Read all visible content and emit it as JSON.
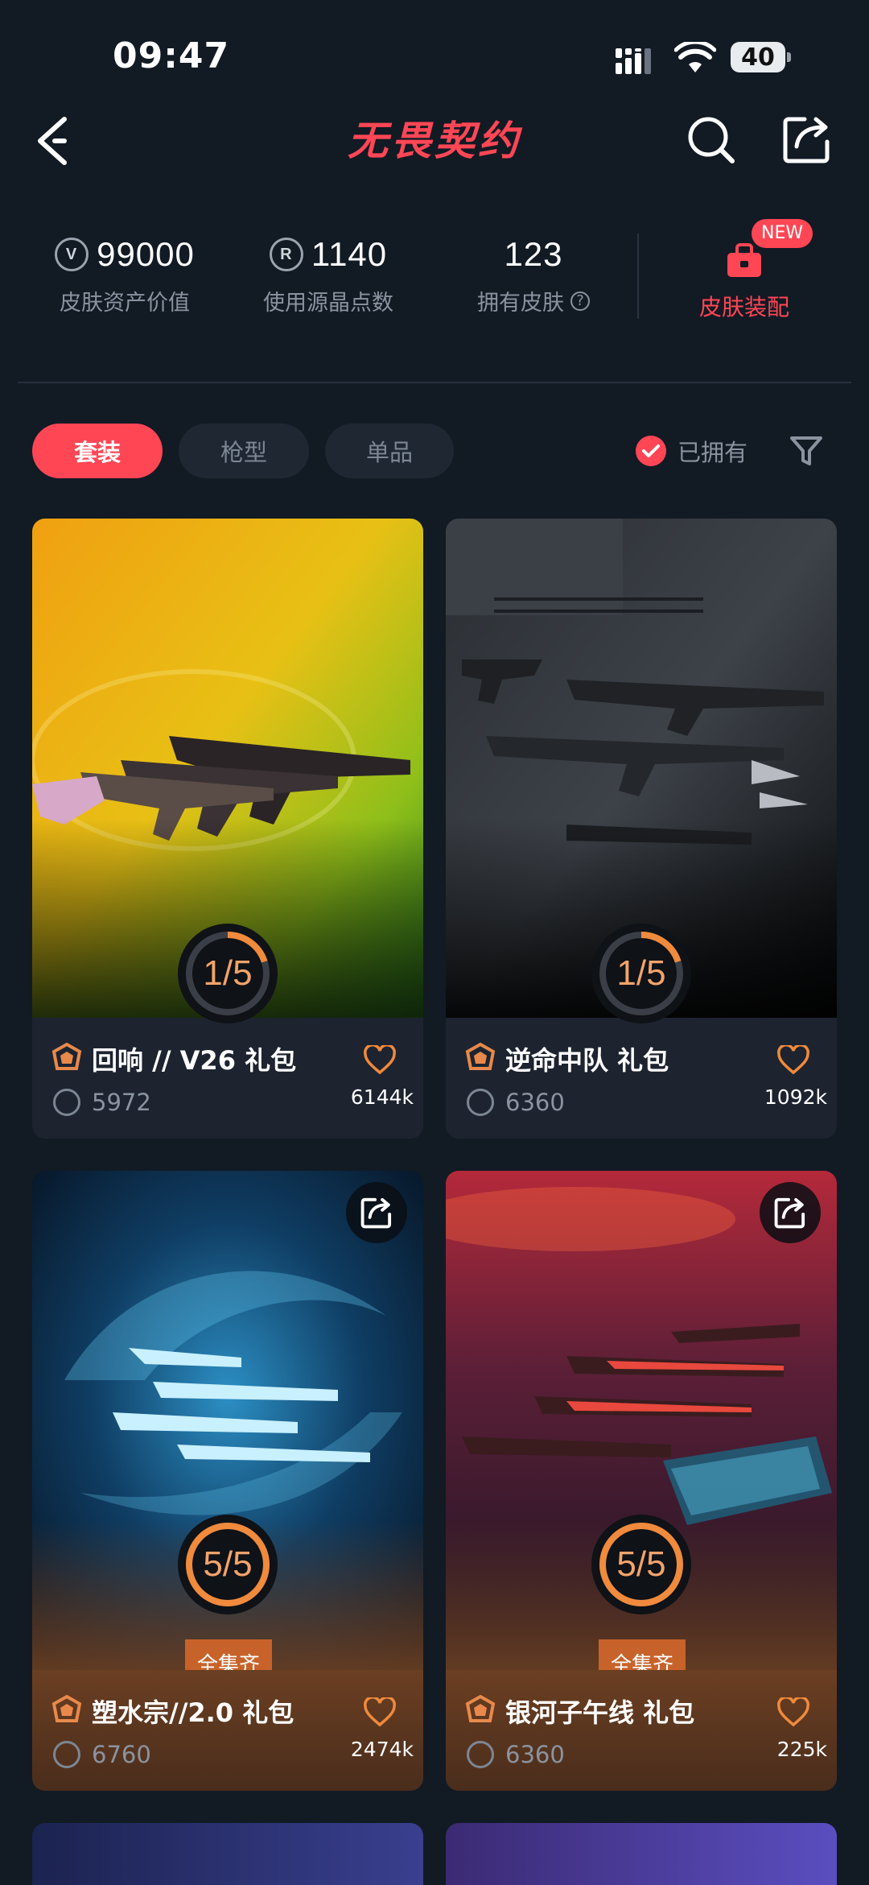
{
  "status_bar": {
    "time": "09:47",
    "battery": "40"
  },
  "header": {
    "title": "无畏契约"
  },
  "stats": [
    {
      "value": "99000",
      "label": "皮肤资产价值",
      "icon": "valorant-points-icon"
    },
    {
      "value": "1140",
      "label": "使用源晶点数",
      "icon": "radianite-icon"
    },
    {
      "value": "123",
      "label": "拥有皮肤",
      "icon": "help-circle-icon"
    }
  ],
  "equip": {
    "label": "皮肤装配",
    "badge": "NEW"
  },
  "tabs": [
    {
      "label": "套装",
      "active": true
    },
    {
      "label": "枪型",
      "active": false
    },
    {
      "label": "单品",
      "active": false
    }
  ],
  "filter": {
    "owned_label": "已拥有"
  },
  "cards": [
    {
      "name": "回响 // V26 礼包",
      "price": "5972",
      "likes": "6144k",
      "progress": "1/5",
      "owned": 1,
      "total": 5
    },
    {
      "name": "逆命中队 礼包",
      "price": "6360",
      "likes": "1092k",
      "progress": "1/5",
      "owned": 1,
      "total": 5
    },
    {
      "name": "塑水宗//2.0 礼包",
      "price": "6760",
      "likes": "2474k",
      "progress": "5/5",
      "owned": 5,
      "total": 5,
      "badge": "全集齐"
    },
    {
      "name": "银河子午线 礼包",
      "price": "6360",
      "likes": "225k",
      "progress": "5/5",
      "owned": 5,
      "total": 5,
      "badge": "全集齐"
    }
  ],
  "colors": {
    "accent": "#ff4655",
    "progress": "#f08a3c",
    "background": "#121a24"
  }
}
